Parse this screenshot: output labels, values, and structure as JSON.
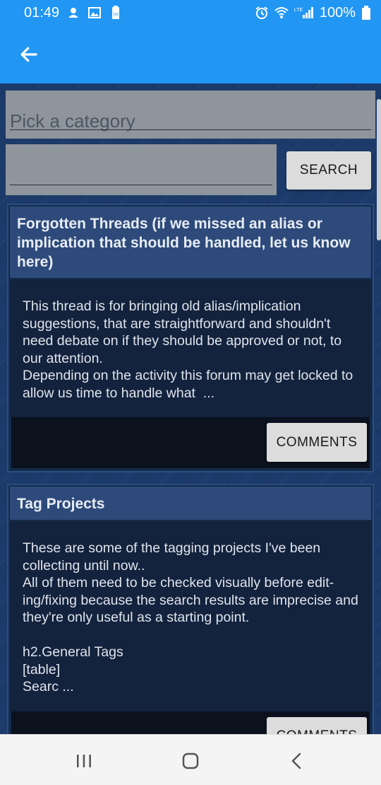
{
  "status_bar": {
    "time": "01:49",
    "battery_percent": "100%",
    "left_icons": [
      "notification-icon",
      "image-icon",
      "battery-saver-icon"
    ],
    "right_icons": [
      "alarm-icon",
      "wifi-icon",
      "lte-signal-icon",
      "battery-icon"
    ]
  },
  "app_bar": {
    "color": "#2196f3",
    "back_icon": "back-arrow-icon"
  },
  "filters": {
    "category_placeholder": "Pick a category",
    "search_value": "",
    "search_button": "SEARCH"
  },
  "threads": [
    {
      "title": "Forgotten Threads (if we missed an alias or implication that should be handled, let us know here)",
      "body": "This thread is for bringing old alias/implication suggestions, that are straightforward and shouldn't need debate on if they should be approved or not, to our attention.\nDepending on the activity this forum may get locked to allow us time to handle what  ...",
      "comments_button": "COMMENTS"
    },
    {
      "title": "Tag Projects",
      "body": "These are some of the tagging projects I've been collecting until now..\nAll of them need to be checked visually before edit-ing/fixing because the search results are imprecise and they're only useful as a starting point.\n\nh2.General Tags\n[table]\nSearc ...",
      "comments_button": "COMMENTS"
    }
  ],
  "nav_bar": {
    "icons": [
      "recent-apps-icon",
      "home-icon",
      "back-icon"
    ]
  }
}
